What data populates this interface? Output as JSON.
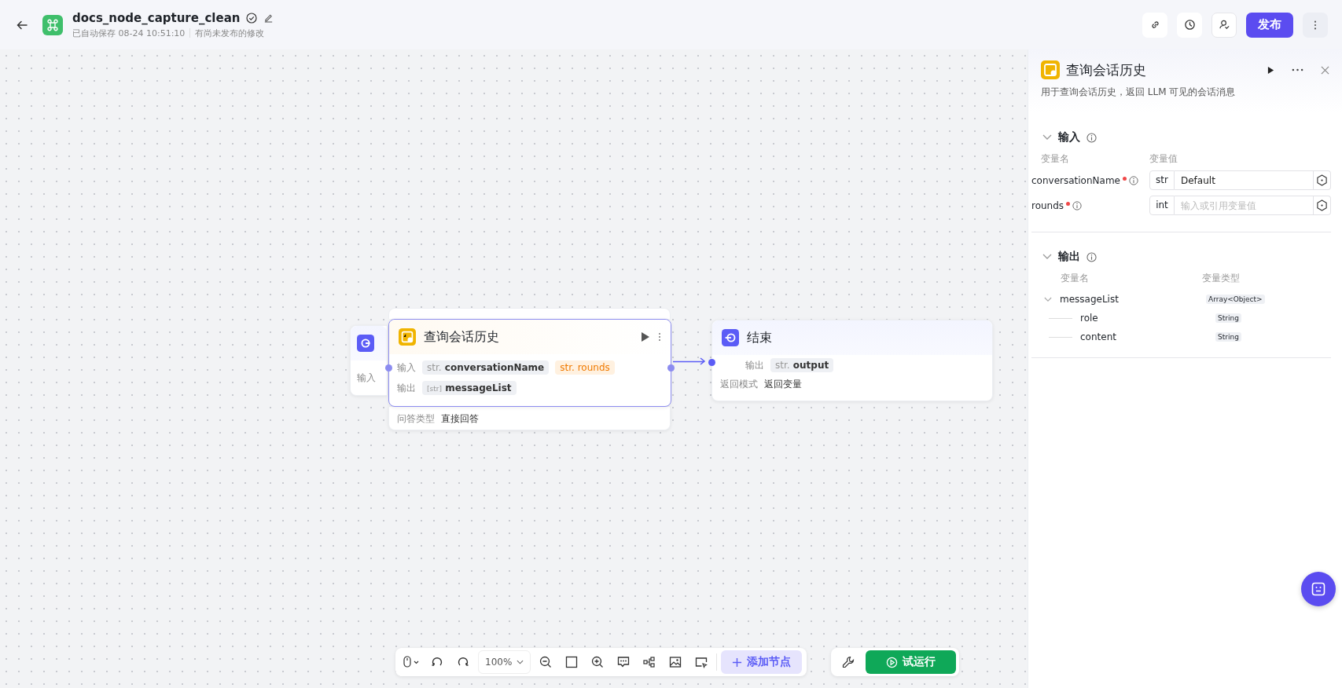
{
  "header": {
    "title": "docs_node_capture_clean",
    "autosave": "已自动保存 08-24 10:51:10",
    "status": "有尚未发布的修改",
    "publish": "发布"
  },
  "start_node": {
    "input_label": "输入"
  },
  "answer_node": {
    "fields": [
      {
        "label": "问答类型",
        "value": "直接回答"
      }
    ]
  },
  "selected_node": {
    "title": "查询会话历史",
    "selected": true,
    "inputs_label": "输入",
    "inputs": [
      {
        "type": "str.",
        "name": "conversationName",
        "warning": false
      },
      {
        "type": "str.",
        "name": "rounds",
        "warning": true
      }
    ],
    "outputs_label": "输出",
    "outputs": [
      {
        "type": "[str]",
        "name": "messageList"
      }
    ]
  },
  "end_node": {
    "title": "结束",
    "output_label": "输出",
    "output": {
      "type": "str.",
      "name": "output"
    },
    "mode_label": "返回模式",
    "mode": "返回变量"
  },
  "panel": {
    "title": "查询会话历史",
    "description": "用于查询会话历史，返回 LLM 可见的会话消息",
    "input_section": {
      "title": "输入",
      "expanded": true,
      "columns": [
        "变量名",
        "变量值"
      ],
      "rows": [
        {
          "name": "conversationName",
          "required": true,
          "type": "str",
          "value": "Default"
        },
        {
          "name": "rounds",
          "required": true,
          "type": "int",
          "placeholder": "输入或引用变量值"
        }
      ]
    },
    "output_section": {
      "title": "输出",
      "expanded": true,
      "columns": [
        "变量名",
        "变量类型"
      ],
      "rows": [
        {
          "name": "messageList",
          "type": "Array<Object>",
          "expanded": true,
          "children": [
            {
              "name": "role",
              "type": "String"
            },
            {
              "name": "content",
              "type": "String"
            }
          ]
        }
      ]
    }
  },
  "toolbar": {
    "zoom": "100%",
    "add_node": "添加节点",
    "test_run": "试运行"
  }
}
